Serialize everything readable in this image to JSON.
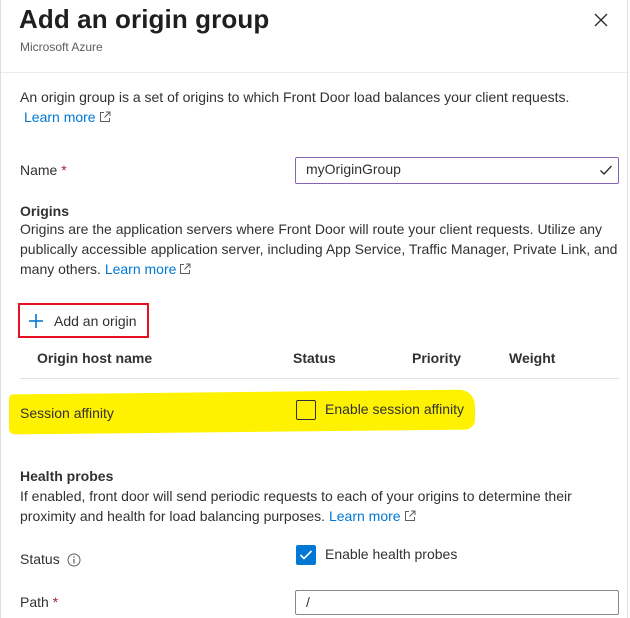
{
  "header": {
    "title": "Add an origin group",
    "subtitle": "Microsoft Azure",
    "close_icon": "close-icon"
  },
  "intro": {
    "text": "An origin group is a set of origins to which Front Door load balances your client requests.",
    "link": "Learn more"
  },
  "name_field": {
    "label": "Name",
    "required_mark": "*",
    "value": "myOriginGroup",
    "valid_icon": "checkmark-icon"
  },
  "origins": {
    "title": "Origins",
    "description": "Origins are the application servers where Front Door will route your client requests. Utilize any publically accessible application server, including App Service, Traffic Manager, Private Link, and many others.",
    "link": "Learn more",
    "add_button": "Add an origin",
    "columns": [
      "Origin host name",
      "Status",
      "Priority",
      "Weight"
    ]
  },
  "session_affinity": {
    "label": "Session affinity",
    "checkbox_label": "Enable session affinity",
    "checked": false,
    "highlight_color": "#fff200"
  },
  "health_probes": {
    "title": "Health probes",
    "description": "If enabled, front door will send periodic requests to each of your origins to determine their proximity and health for load balancing purposes.",
    "link": "Learn more",
    "status_label": "Status",
    "status_checkbox_label": "Enable health probes",
    "status_checked": true,
    "path_label": "Path",
    "path_required_mark": "*",
    "path_value": "/"
  },
  "colors": {
    "accent": "#0078d4",
    "required": "#a4262c",
    "annotation_box": "#e81123"
  }
}
